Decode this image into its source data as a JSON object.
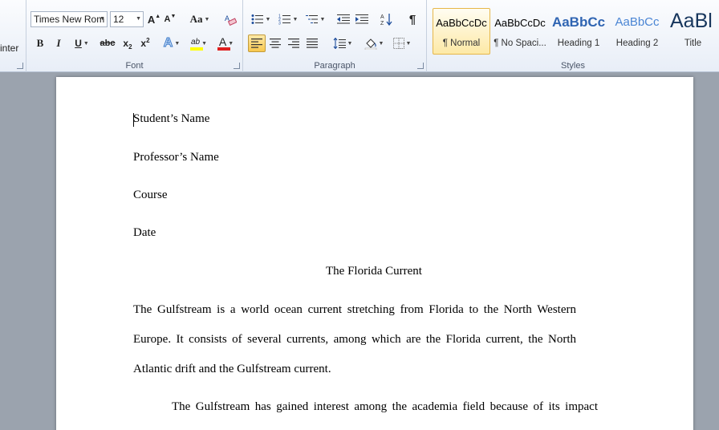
{
  "ribbon": {
    "clipboard": {
      "format_painter_partial": "inter"
    },
    "font": {
      "label": "Font",
      "font_name": "Times New Rom",
      "font_size": "12",
      "grow_label": "A",
      "shrink_label": "A",
      "case_label": "Aa",
      "bold": "B",
      "italic": "I",
      "underline": "U",
      "strikethrough": "abc",
      "subscript": "x",
      "subscript_mark": "2",
      "superscript": "x",
      "superscript_mark": "2",
      "effects": "A",
      "highlight": "ab",
      "font_color": "A",
      "highlight_color": "#ffff00",
      "font_color_value": "#e02020"
    },
    "paragraph": {
      "label": "Paragraph",
      "show_marks": "¶"
    },
    "styles": {
      "label": "Styles",
      "items": [
        {
          "sample": "AaBbCcDc",
          "name": "¶ Normal",
          "selected": true
        },
        {
          "sample": "AaBbCcDc",
          "name": "¶ No Spaci...",
          "selected": false
        },
        {
          "sample": "AaBbCc",
          "name": "Heading 1",
          "selected": false
        },
        {
          "sample": "AaBbCc",
          "name": "Heading 2",
          "selected": false
        },
        {
          "sample": "AaBl",
          "name": "Title",
          "selected": false
        }
      ]
    }
  },
  "document": {
    "student_name": "Student’s Name",
    "professor_name": "Professor’s Name",
    "course": "Course",
    "date": "Date",
    "title": "The Florida Current",
    "para1_line1": "The Gulfstream is a world ocean current stretching from Florida to the North Western",
    "para1_line2": "Europe. It consists of several currents, among which are the Florida current, the North",
    "para1_line3": "Atlantic drift and the Gulfstream current.",
    "para2_line1": "The Gulfstream has gained interest among the academia field because of its impact"
  }
}
